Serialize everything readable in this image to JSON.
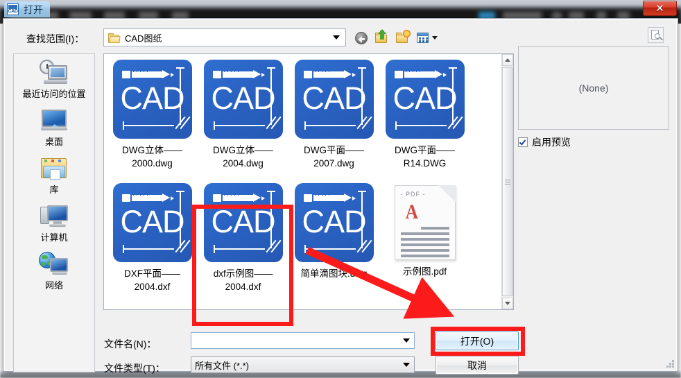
{
  "window": {
    "title": "打开",
    "title_icon": "cad-icon",
    "close_label": "✕"
  },
  "lookin": {
    "label": "查找范围(I)：",
    "folder_icon": "folder-icon",
    "path": "CAD图纸"
  },
  "toolbar": {
    "items": [
      {
        "name": "back-icon",
        "tooltip": "后退"
      },
      {
        "name": "up-folder-icon",
        "tooltip": "上一级"
      },
      {
        "name": "new-folder-icon",
        "tooltip": "新建文件夹"
      },
      {
        "name": "views-icon",
        "tooltip": "视图"
      }
    ]
  },
  "places": {
    "items": [
      {
        "label": "最近访问的位置",
        "icon": "recent-places-icon"
      },
      {
        "label": "桌面",
        "icon": "desktop-icon"
      },
      {
        "label": "库",
        "icon": "libraries-icon"
      },
      {
        "label": "计算机",
        "icon": "computer-icon"
      },
      {
        "label": "网络",
        "icon": "network-icon"
      }
    ]
  },
  "files": {
    "items": [
      {
        "name": "DWG立体——\n2000.dwg",
        "line1": "DWG立体——",
        "line2": "2000.dwg",
        "type": "cad",
        "selected": false
      },
      {
        "name": "DWG立体——\n2004.dwg",
        "line1": "DWG立体——",
        "line2": "2004.dwg",
        "type": "cad",
        "selected": false
      },
      {
        "name": "DWG平面——\n2007.dwg",
        "line1": "DWG平面——",
        "line2": "2007.dwg",
        "type": "cad",
        "selected": false
      },
      {
        "name": "DWG平面——\nR14.DWG",
        "line1": "DWG平面——",
        "line2": "R14.DWG",
        "type": "cad",
        "selected": false
      },
      {
        "name": "DXF平面——\n2004.dxf",
        "line1": "DXF平面——",
        "line2": "2004.dxf",
        "type": "cad",
        "selected": false
      },
      {
        "name": "dxf示例图——\n2004.dxf",
        "line1": "dxf示例图——",
        "line2": "2004.dxf",
        "type": "cad",
        "selected": true
      },
      {
        "name": "简单滴图块.dwg",
        "line1": "简单滴图块.dwg",
        "line2": "",
        "type": "cad",
        "selected": false
      },
      {
        "name": "示例图.pdf",
        "line1": "示例图.pdf",
        "line2": "",
        "type": "pdf",
        "selected": false
      }
    ],
    "cad_icon_text": "CAD",
    "pdf_icon_text": "- PDF -"
  },
  "preview": {
    "tool_icon": "preview-zoom-icon",
    "none_text": "(None)",
    "checkbox_label": "启用预览",
    "checkbox_checked": true
  },
  "fields": {
    "filename_label": "文件名(N)：",
    "filename_value": "",
    "filename_placeholder": "",
    "filetype_label": "文件类型(T)：",
    "filetype_value": "所有文件 (*.*)"
  },
  "buttons": {
    "open_label": "打开(O)",
    "cancel_label": "取消"
  },
  "annotations": {
    "highlight_color": "#fb1b1b",
    "arrow_from": "dxf示例图——2004.dxf",
    "arrow_to": "打开(O)"
  }
}
